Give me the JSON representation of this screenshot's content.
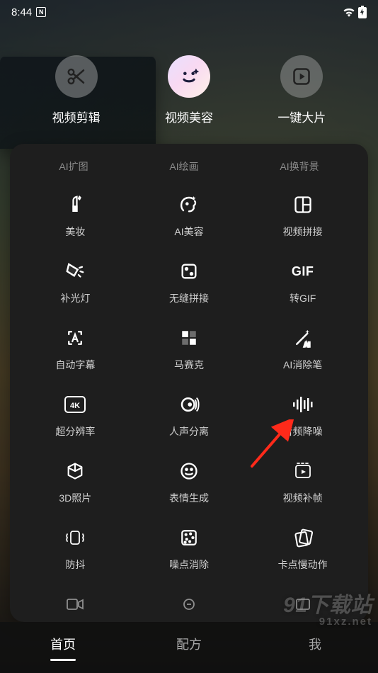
{
  "status": {
    "time": "8:44",
    "wifi": true,
    "battery": true
  },
  "top_tabs": [
    {
      "id": "video-edit",
      "label": "视频剪辑",
      "icon": "scissors",
      "style": "dim"
    },
    {
      "id": "video-beauty",
      "label": "视频美容",
      "icon": "face",
      "style": "gradient",
      "active": true
    },
    {
      "id": "one-click",
      "label": "一键大片",
      "icon": "play-box",
      "style": "solid"
    }
  ],
  "sub_tabs": [
    {
      "id": "ai-expand",
      "label": "AI扩图"
    },
    {
      "id": "ai-draw",
      "label": "AI绘画"
    },
    {
      "id": "ai-bg",
      "label": "AI换背景"
    }
  ],
  "features": [
    {
      "id": "makeup",
      "label": "美妆",
      "icon": "lipstick"
    },
    {
      "id": "ai-beauty",
      "label": "AI美容",
      "icon": "ai-face"
    },
    {
      "id": "video-stitch",
      "label": "视频拼接",
      "icon": "collage"
    },
    {
      "id": "fill-light",
      "label": "补光灯",
      "icon": "light"
    },
    {
      "id": "seamless-stitch",
      "label": "无缝拼接",
      "icon": "dice"
    },
    {
      "id": "to-gif",
      "label": "转GIF",
      "icon": "gif-text"
    },
    {
      "id": "auto-subtitle",
      "label": "自动字幕",
      "icon": "subtitle"
    },
    {
      "id": "mosaic",
      "label": "马赛克",
      "icon": "mosaic"
    },
    {
      "id": "ai-erase",
      "label": "AI消除笔",
      "icon": "wand"
    },
    {
      "id": "super-res",
      "label": "超分辨率",
      "icon": "4k"
    },
    {
      "id": "voice-separate",
      "label": "人声分离",
      "icon": "voice"
    },
    {
      "id": "audio-denoise",
      "label": "音频降噪",
      "icon": "audio-bars",
      "annotated": true
    },
    {
      "id": "3d-photo",
      "label": "3D照片",
      "icon": "cube3d"
    },
    {
      "id": "emoji-gen",
      "label": "表情生成",
      "icon": "emoji"
    },
    {
      "id": "frame-interp",
      "label": "视频补帧",
      "icon": "frame-plus"
    },
    {
      "id": "anti-shake",
      "label": "防抖",
      "icon": "antishake"
    },
    {
      "id": "noise-remove",
      "label": "噪点消除",
      "icon": "noise"
    },
    {
      "id": "slow-mo",
      "label": "卡点慢动作",
      "icon": "cards"
    }
  ],
  "bottom_nav": [
    {
      "id": "home",
      "label": "首页",
      "active": true
    },
    {
      "id": "recipe",
      "label": "配方"
    },
    {
      "id": "me",
      "label": "我"
    }
  ],
  "watermark": {
    "line1": "91下载站",
    "line2": "91xz.net"
  }
}
